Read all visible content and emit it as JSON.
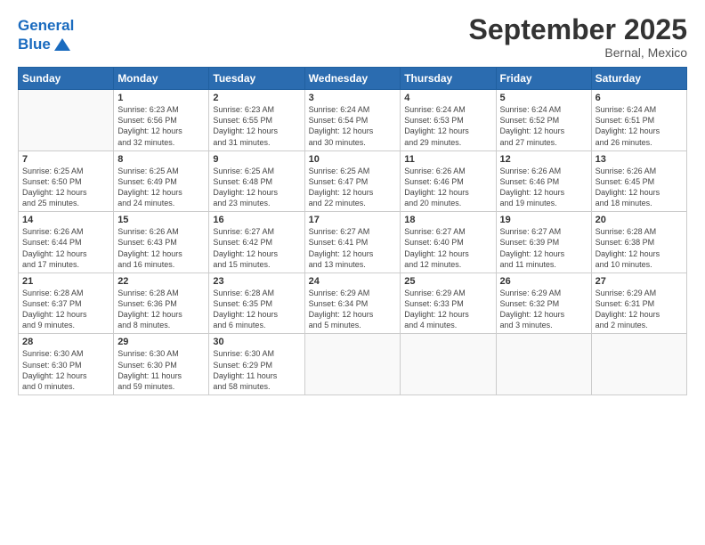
{
  "header": {
    "logo_line1": "General",
    "logo_line2": "Blue",
    "month_title": "September 2025",
    "location": "Bernal, Mexico"
  },
  "days_of_week": [
    "Sunday",
    "Monday",
    "Tuesday",
    "Wednesday",
    "Thursday",
    "Friday",
    "Saturday"
  ],
  "weeks": [
    [
      {
        "day": "",
        "info": ""
      },
      {
        "day": "1",
        "info": "Sunrise: 6:23 AM\nSunset: 6:56 PM\nDaylight: 12 hours\nand 32 minutes."
      },
      {
        "day": "2",
        "info": "Sunrise: 6:23 AM\nSunset: 6:55 PM\nDaylight: 12 hours\nand 31 minutes."
      },
      {
        "day": "3",
        "info": "Sunrise: 6:24 AM\nSunset: 6:54 PM\nDaylight: 12 hours\nand 30 minutes."
      },
      {
        "day": "4",
        "info": "Sunrise: 6:24 AM\nSunset: 6:53 PM\nDaylight: 12 hours\nand 29 minutes."
      },
      {
        "day": "5",
        "info": "Sunrise: 6:24 AM\nSunset: 6:52 PM\nDaylight: 12 hours\nand 27 minutes."
      },
      {
        "day": "6",
        "info": "Sunrise: 6:24 AM\nSunset: 6:51 PM\nDaylight: 12 hours\nand 26 minutes."
      }
    ],
    [
      {
        "day": "7",
        "info": "Sunrise: 6:25 AM\nSunset: 6:50 PM\nDaylight: 12 hours\nand 25 minutes."
      },
      {
        "day": "8",
        "info": "Sunrise: 6:25 AM\nSunset: 6:49 PM\nDaylight: 12 hours\nand 24 minutes."
      },
      {
        "day": "9",
        "info": "Sunrise: 6:25 AM\nSunset: 6:48 PM\nDaylight: 12 hours\nand 23 minutes."
      },
      {
        "day": "10",
        "info": "Sunrise: 6:25 AM\nSunset: 6:47 PM\nDaylight: 12 hours\nand 22 minutes."
      },
      {
        "day": "11",
        "info": "Sunrise: 6:26 AM\nSunset: 6:46 PM\nDaylight: 12 hours\nand 20 minutes."
      },
      {
        "day": "12",
        "info": "Sunrise: 6:26 AM\nSunset: 6:46 PM\nDaylight: 12 hours\nand 19 minutes."
      },
      {
        "day": "13",
        "info": "Sunrise: 6:26 AM\nSunset: 6:45 PM\nDaylight: 12 hours\nand 18 minutes."
      }
    ],
    [
      {
        "day": "14",
        "info": "Sunrise: 6:26 AM\nSunset: 6:44 PM\nDaylight: 12 hours\nand 17 minutes."
      },
      {
        "day": "15",
        "info": "Sunrise: 6:26 AM\nSunset: 6:43 PM\nDaylight: 12 hours\nand 16 minutes."
      },
      {
        "day": "16",
        "info": "Sunrise: 6:27 AM\nSunset: 6:42 PM\nDaylight: 12 hours\nand 15 minutes."
      },
      {
        "day": "17",
        "info": "Sunrise: 6:27 AM\nSunset: 6:41 PM\nDaylight: 12 hours\nand 13 minutes."
      },
      {
        "day": "18",
        "info": "Sunrise: 6:27 AM\nSunset: 6:40 PM\nDaylight: 12 hours\nand 12 minutes."
      },
      {
        "day": "19",
        "info": "Sunrise: 6:27 AM\nSunset: 6:39 PM\nDaylight: 12 hours\nand 11 minutes."
      },
      {
        "day": "20",
        "info": "Sunrise: 6:28 AM\nSunset: 6:38 PM\nDaylight: 12 hours\nand 10 minutes."
      }
    ],
    [
      {
        "day": "21",
        "info": "Sunrise: 6:28 AM\nSunset: 6:37 PM\nDaylight: 12 hours\nand 9 minutes."
      },
      {
        "day": "22",
        "info": "Sunrise: 6:28 AM\nSunset: 6:36 PM\nDaylight: 12 hours\nand 8 minutes."
      },
      {
        "day": "23",
        "info": "Sunrise: 6:28 AM\nSunset: 6:35 PM\nDaylight: 12 hours\nand 6 minutes."
      },
      {
        "day": "24",
        "info": "Sunrise: 6:29 AM\nSunset: 6:34 PM\nDaylight: 12 hours\nand 5 minutes."
      },
      {
        "day": "25",
        "info": "Sunrise: 6:29 AM\nSunset: 6:33 PM\nDaylight: 12 hours\nand 4 minutes."
      },
      {
        "day": "26",
        "info": "Sunrise: 6:29 AM\nSunset: 6:32 PM\nDaylight: 12 hours\nand 3 minutes."
      },
      {
        "day": "27",
        "info": "Sunrise: 6:29 AM\nSunset: 6:31 PM\nDaylight: 12 hours\nand 2 minutes."
      }
    ],
    [
      {
        "day": "28",
        "info": "Sunrise: 6:30 AM\nSunset: 6:30 PM\nDaylight: 12 hours\nand 0 minutes."
      },
      {
        "day": "29",
        "info": "Sunrise: 6:30 AM\nSunset: 6:30 PM\nDaylight: 11 hours\nand 59 minutes."
      },
      {
        "day": "30",
        "info": "Sunrise: 6:30 AM\nSunset: 6:29 PM\nDaylight: 11 hours\nand 58 minutes."
      },
      {
        "day": "",
        "info": ""
      },
      {
        "day": "",
        "info": ""
      },
      {
        "day": "",
        "info": ""
      },
      {
        "day": "",
        "info": ""
      }
    ]
  ]
}
